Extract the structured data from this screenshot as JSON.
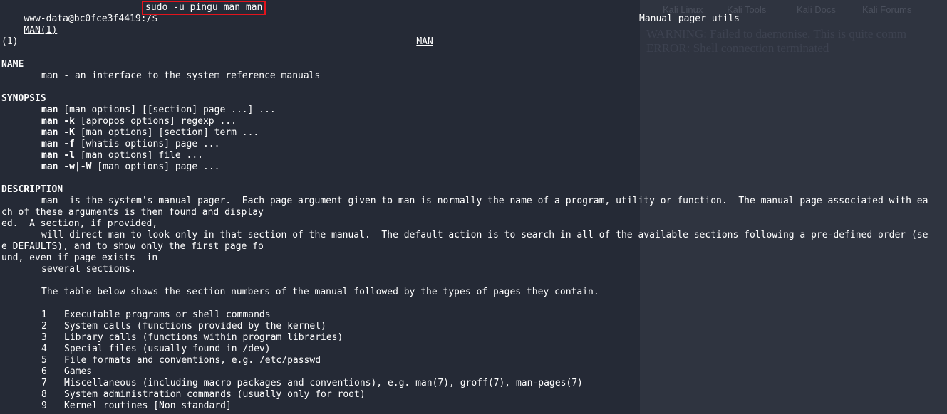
{
  "terminal": {
    "prompt": "www-data@bc0fce3f4419:/$",
    "command": "sudo -u pingu man man",
    "header_left": "MAN(1)",
    "header_center": "MAN",
    "header_right": "Manual pager utils",
    "header_section": "(1)"
  },
  "sections": {
    "name_heading": "NAME",
    "name_text": "man - an interface to the system reference manuals",
    "synopsis_heading": "SYNOPSIS",
    "synopsis": [
      {
        "cmd": "man",
        "rest": " [man options] [[section] page ...] ..."
      },
      {
        "cmd": "man -k",
        "rest": " [apropos options] regexp ..."
      },
      {
        "cmd": "man -K",
        "rest": " [man options] [section] term ..."
      },
      {
        "cmd": "man -f",
        "rest": " [whatis options] page ..."
      },
      {
        "cmd": "man -l",
        "rest": " [man options] file ..."
      },
      {
        "cmd": "man -w|-W",
        "rest": " [man options] page ..."
      }
    ],
    "description_heading": "DESCRIPTION",
    "desc_line1": "man  is the system's manual pager.  Each page argument given to man is normally the name of a program, utility or function.  The manual page associated with ea",
    "desc_line2": "ch of these arguments is then found and display",
    "desc_line3": "ed.  A section, if provided,",
    "desc_line4": "will direct man to look only in that section of the manual.  The default action is to search in all of the available sections following a pre-defined order (se",
    "desc_line5": "e DEFAULTS), and to show only the first page fo",
    "desc_line6": "und, even if page exists  in",
    "desc_line7": "several sections.",
    "table_intro": "The table below shows the section numbers of the manual followed by the types of pages they contain.",
    "table": [
      {
        "n": "1",
        "t": "Executable programs or shell commands"
      },
      {
        "n": "2",
        "t": "System calls (functions provided by the kernel)"
      },
      {
        "n": "3",
        "t": "Library calls (functions within program libraries)"
      },
      {
        "n": "4",
        "t": "Special files (usually found in /dev)"
      },
      {
        "n": "5",
        "t": "File formats and conventions, e.g. /etc/passwd"
      },
      {
        "n": "6",
        "t": "Games"
      },
      {
        "n": "7",
        "t": "Miscellaneous (including macro packages and conventions), e.g. man(7), groff(7), man-pages(7)"
      },
      {
        "n": "8",
        "t": "System administration commands (usually only for root)"
      },
      {
        "n": "9",
        "t": "Kernel routines [Non standard]"
      }
    ]
  },
  "background": {
    "tabs": [
      "Kali Linux",
      "Kali Tools",
      "Kali Docs",
      "Kali Forums"
    ],
    "warning": "WARNING: Failed to daemonise. This is quite comm",
    "error": "ERROR: Shell connection terminated"
  }
}
